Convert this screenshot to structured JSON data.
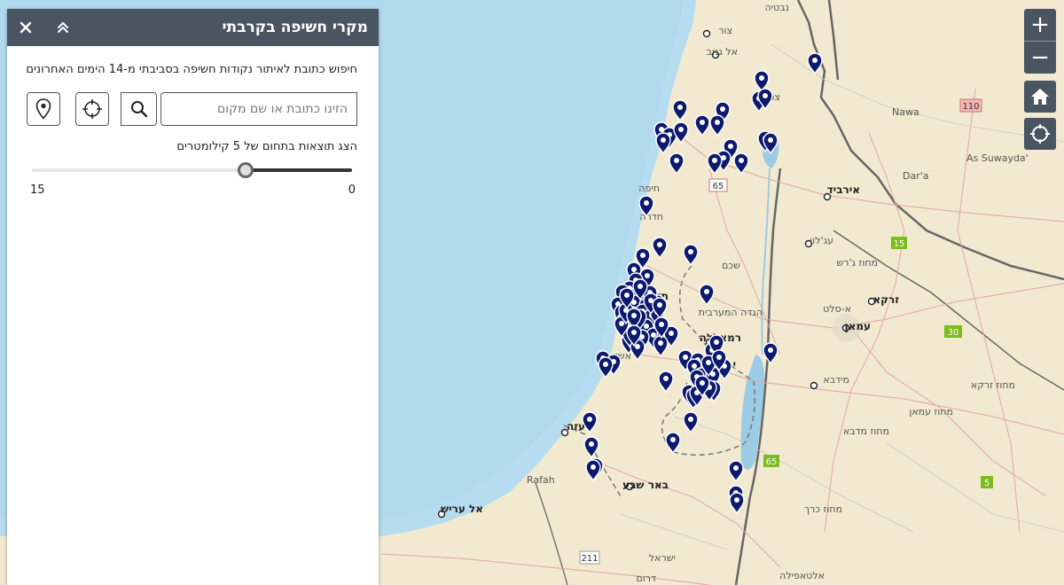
{
  "panel": {
    "title": "מקרי חשיפה בקרבתי",
    "description": "חיפוש כתובת לאיתור נקודות חשיפה בסביבתי מ-14 הימים האחרונים",
    "search_placeholder": "הזינו כתובת או שם מקום",
    "radius_label": "הצג תוצאות בתחום של 5 קילומטרים",
    "slider": {
      "min": 0,
      "max": 15,
      "value": 5,
      "min_label": "0",
      "max_label": "15"
    }
  },
  "map_labels": [
    "צור",
    "אל גנוב",
    "נבטיה",
    "צפת",
    "חיפה",
    "חדרה",
    "אירביד",
    "עג'לון",
    "Nawa",
    "As Suwayda'",
    "Dar'a",
    "מחוז ג'רש",
    "שכם",
    "הגדה המערבית",
    "א-סלט",
    "זרקא",
    "תל",
    "עמאן",
    "רמאללה",
    "ירוש",
    "מחוז זרקא",
    "מידבא",
    "אשד",
    "עזה",
    "מחוז עמאן",
    "מחוז מדבא",
    "Rafah",
    "באר שבע",
    "אל עריש",
    "מחוז כרך",
    "ישראל",
    "דרום",
    "אלטאפילה"
  ],
  "road_labels": [
    "65",
    "110",
    "15",
    "30",
    "65",
    "5",
    "211"
  ],
  "markers_count": 95,
  "colors": {
    "header": "#4a5562",
    "marker": "#0d1a6e",
    "sea": "#b6dcef",
    "land": "#f2ead0"
  },
  "controls": {
    "zoom_in": "+",
    "zoom_out": "−",
    "icons": [
      "close-icon",
      "collapse-icon",
      "search-icon",
      "crosshair-icon",
      "location-pin-icon",
      "home-icon",
      "locate-icon"
    ]
  }
}
